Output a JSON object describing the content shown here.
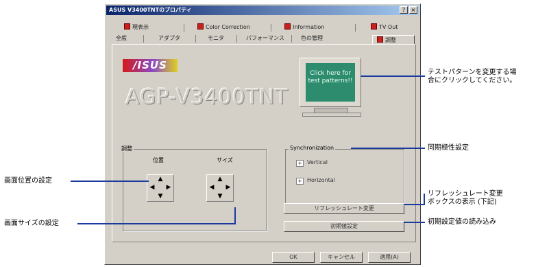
{
  "window": {
    "title": "ASUS V3400TNTのプロパティ",
    "close_glyph": "×",
    "help_glyph": "?"
  },
  "tabs_row1": [
    {
      "label": "現表示"
    },
    {
      "label": "Color Correction"
    },
    {
      "label": "Information"
    },
    {
      "label": "TV Out"
    }
  ],
  "tabs_row2": [
    {
      "label": "全般"
    },
    {
      "label": "アダプタ"
    },
    {
      "label": "モニタ"
    },
    {
      "label": "パフォーマンス"
    },
    {
      "label": "色の管理"
    },
    {
      "label": "調整"
    }
  ],
  "logo": {
    "text": "/ISUS"
  },
  "product_name": "AGP-V3400TNT",
  "monitor": {
    "screen_text": "Click here for test patterns!!"
  },
  "adjust_group": {
    "label": "調整",
    "position_label": "位置",
    "size_label": "サイズ"
  },
  "sync_group": {
    "label": "Synchronization",
    "vertical_label": "Vertical",
    "horizontal_label": "Horizontal",
    "vertical_mark": "+",
    "horizontal_mark": "+"
  },
  "buttons": {
    "refresh": "リフレッシュレート変更",
    "defaults": "初期値設定",
    "ok": "OK",
    "cancel": "キャンセル",
    "apply": "適用(A)"
  },
  "annotations": {
    "test_pattern": [
      "テストパターンを変更する場",
      "合にクリックしてください。"
    ],
    "sync_polarity": "同期極性設定",
    "refresh_box": [
      "リフレッシュレート変更",
      "ボックスの表示 (下記)"
    ],
    "load_defaults": "初期設定値の読み込み",
    "screen_position": "画面位置の設定",
    "screen_size": "画面サイズの設定"
  },
  "colors": {
    "callout_line": "#1a3a9e",
    "title_bar": "#0a246a",
    "screen": "#2e8c6e"
  }
}
